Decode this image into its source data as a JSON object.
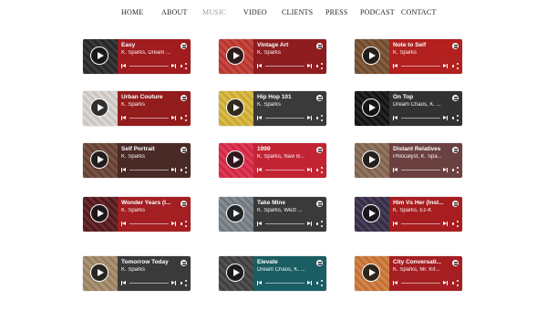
{
  "nav": {
    "items": [
      {
        "label": "HOME"
      },
      {
        "label": "ABOUT"
      },
      {
        "label": "MUSIC",
        "active": true
      },
      {
        "label": "VIDEO"
      },
      {
        "label": "CLIENTS"
      },
      {
        "label": "PRESS"
      },
      {
        "label": "PODCAST"
      },
      {
        "label": "CONTACT"
      }
    ]
  },
  "tracks": [
    {
      "title": "Easy",
      "artist": "K. Sparks, Dream ...",
      "color": "#a01c1f",
      "art": "#2a2a2a"
    },
    {
      "title": "Vintage Art",
      "artist": "K. Sparks",
      "color": "#8e1d1f",
      "art": "#c23a32"
    },
    {
      "title": "Note to Self",
      "artist": "K. Sparks",
      "color": "#b2201f",
      "art": "#7a5030"
    },
    {
      "title": "Urban Couture",
      "artist": "K. Sparks",
      "color": "#931c1c",
      "art": "#d9d4cf"
    },
    {
      "title": "Hip Hop 101",
      "artist": "K. Sparks",
      "color": "#3a3a3a",
      "art": "#d8b63a"
    },
    {
      "title": "On Top",
      "artist": "Dream Chaos, K. ...",
      "color": "#323232",
      "art": "#141414"
    },
    {
      "title": "Self Portrait",
      "artist": "K. Sparks",
      "color": "#4a2a26",
      "art": "#6b4536"
    },
    {
      "title": "1999",
      "artist": "K. Sparks, Navi B...",
      "color": "#c22433",
      "art": "#e02a4a"
    },
    {
      "title": "Distant Relatives",
      "artist": "Phlocalyst, K. Spa...",
      "color": "#6b4040",
      "art": "#8a6a55"
    },
    {
      "title": "Wonder Years (I...",
      "artist": "K. Sparks",
      "color": "#a31f22",
      "art": "#5a1a1c"
    },
    {
      "title": "Take Mine",
      "artist": "K. Sparks, Wezt ...",
      "color": "#3a3a3a",
      "art": "#7a8188"
    },
    {
      "title": "Him Vs Her (Inst...",
      "artist": "K. Sparks, Ez-K",
      "color": "#a81d1f",
      "art": "#3b2f4a"
    },
    {
      "title": "Tomorrow Today",
      "artist": "K. Sparks",
      "color": "#3a3a3a",
      "art": "#a48a6a"
    },
    {
      "title": "Elevate",
      "artist": "Dream Chaos, K. ...",
      "color": "#1a5d63",
      "art": "#444444"
    },
    {
      "title": "City Conversati...",
      "artist": "K. Sparks, Mr. Kif...",
      "color": "#a51f22",
      "art": "#d07a3a"
    }
  ]
}
